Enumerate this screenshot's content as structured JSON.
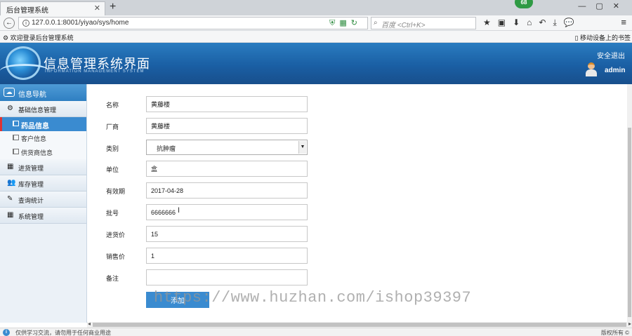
{
  "browser": {
    "tab_title": "后台管理系统",
    "tab_close": "✕",
    "new_tab": "+",
    "window_controls": "—▢✕",
    "badge": "68",
    "url": "127.0.0.1:8001/yiyao/sys/home",
    "search_placeholder": "百度 <Ctrl+K>",
    "bookmark_left": "欢迎登录后台管理系统",
    "bookmark_right": "移动设备上的书签"
  },
  "header": {
    "title": "信息管理系统界面",
    "subtitle": "INFORMATION MANAGEMENT SYSTEM",
    "logout": "安全退出",
    "username": "admin"
  },
  "sidebar": {
    "heading": "信息导航",
    "groups": [
      {
        "label": "基础信息管理",
        "icon": "gears-icon"
      },
      {
        "label": "进货管理",
        "icon": "calendar-icon"
      },
      {
        "label": "库存管理",
        "icon": "users-icon"
      },
      {
        "label": "查询统计",
        "icon": "edit-icon"
      },
      {
        "label": "系统管理",
        "icon": "calendar-icon"
      }
    ],
    "items": [
      {
        "label": "药品信息",
        "active": true
      },
      {
        "label": "客户信息",
        "active": false
      },
      {
        "label": "供货商信息",
        "active": false
      }
    ]
  },
  "form": {
    "fields": [
      {
        "label": "名称",
        "value": "黄藤楼"
      },
      {
        "label": "厂商",
        "value": "黄藤楼"
      },
      {
        "label": "类别",
        "value": "抗肿瘤"
      },
      {
        "label": "单位",
        "value": "盒"
      },
      {
        "label": "有效期",
        "value": "2017-04-28"
      },
      {
        "label": "批号",
        "value": "6666666"
      },
      {
        "label": "进货价",
        "value": "15"
      },
      {
        "label": "销售价",
        "value": "1"
      },
      {
        "label": "备注",
        "value": ""
      }
    ],
    "submit_label": "添加"
  },
  "watermark": "https://www.huzhan.com/ishop39397",
  "status": {
    "left": "仅供学习交流，请勿用于任何商业用途",
    "right": "版权所有 ©"
  },
  "colors": {
    "header_blue": "#1a5fa4",
    "sidebar_active": "#3a8bd0",
    "submit_button": "#3a8bd0"
  }
}
